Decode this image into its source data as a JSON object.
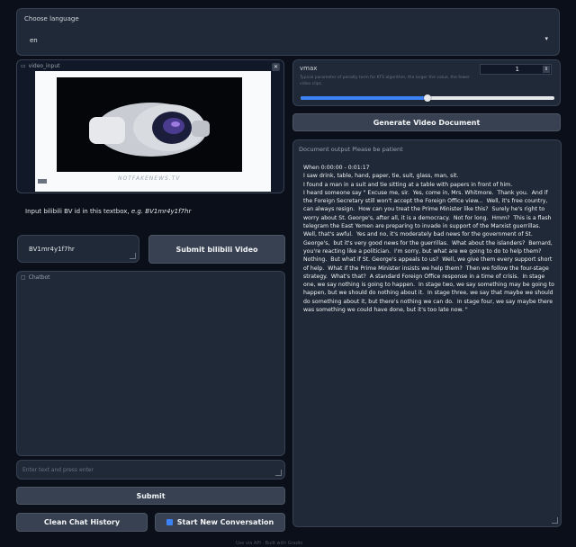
{
  "language": {
    "label": "Choose language",
    "value": "en"
  },
  "video": {
    "label": "video_input",
    "watermark": "NOTFAKENEWS.TV"
  },
  "bv_hint": {
    "prefix": "Input bilibili BV id in this textbox, ",
    "example": "e.g. BV1mr4y1f7hr"
  },
  "bv_input": {
    "value": "BV1mr4y1f7hr"
  },
  "submit_video_label": "Submit bilibili Video",
  "chatbot": {
    "label": "Chatbot"
  },
  "chat_input": {
    "placeholder": "Enter text and press enter"
  },
  "submit_label": "Submit",
  "clean_label": "Clean Chat History",
  "new_convo_label": "Start New Conversation",
  "vmax": {
    "label": "vmax",
    "value": "1",
    "description": "Typical parameter of penalty term for KTS algorithm, the larger the value, the fewer video clips.",
    "slider_fraction": 0.5
  },
  "generate_label": "Generate Video Document",
  "document": {
    "label": "Document output Please be patient",
    "text": "When 0:00:00 - 0:01:17\nI saw drink, table, hand, paper, tie, suit, glass, man, sit.\nI found a man in a suit and tie sitting at a table with papers in front of him.\nI heard someone say \" Excuse me, sir.  Yes, come in, Mrs. Whitmore.  Thank you.  And if the Foreign Secretary still won't accept the Foreign Office view...  Well, it's free country, can always resign.  How can you treat the Prime Minister like this?  Surely he's right to worry about St. George's, after all, it is a democracy.  Not for long.  Hmm?  This is a flash telegram the East Yemen are preparing to invade in support of the Marxist guerrillas.  Well, that's awful.  Yes and no, it's moderately bad news for the government of St. George's,  but it's very good news for the guerrillas.  What about the islanders?  Bernard, you're reacting like a politician.  I'm sorry, but what are we going to do to help them?  Nothing.  But what if St. George's appeals to us?  Well, we give them every support short of help.  What if the Prime Minister insists we help them?  Then we follow the four-stage strategy.  What's that?  A standard Foreign Office response in a time of crisis.  In stage one, we say nothing is going to happen.  In stage two, we say something may be going to happen, but we should do nothing about it.  In stage three, we say that maybe we should do something about it, but there's nothing we can do.  In stage four, we say maybe there was something we could have done, but it's too late now. \""
  },
  "footer": "Use via API · Built with Gradio",
  "colors": {
    "accent": "#3b82f6",
    "panel": "#1f2937",
    "bg": "#0b0f19"
  }
}
